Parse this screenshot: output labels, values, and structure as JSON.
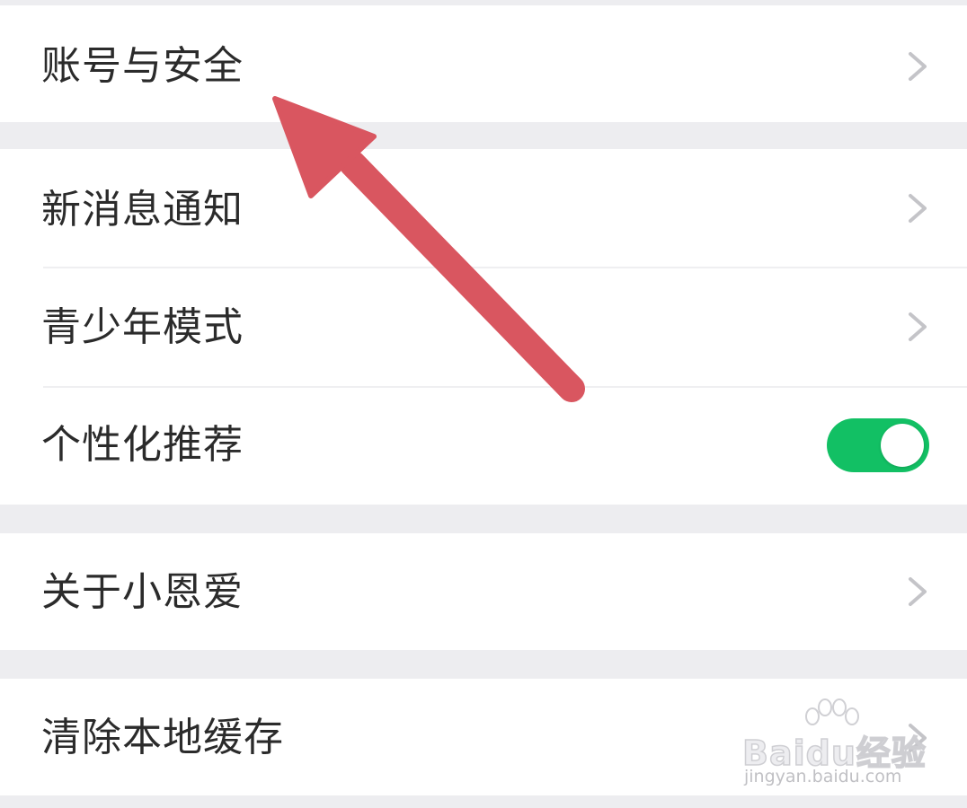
{
  "settings": {
    "account_security": "账号与安全",
    "new_message_notify": "新消息通知",
    "teen_mode": "青少年模式",
    "personalized_recommend": "个性化推荐",
    "personalized_recommend_enabled": true,
    "about": "关于小恩爱",
    "clear_cache": "清除本地缓存"
  },
  "colors": {
    "toggle_on": "#12c064",
    "arrow": "#d95660",
    "section_gap": "#ededf0"
  },
  "watermark": {
    "logo": "Baidu经验",
    "url": "jingyan.baidu.com"
  },
  "icons": {
    "chevron": "chevron-right-icon",
    "arrow": "red-arrow-annotation"
  }
}
